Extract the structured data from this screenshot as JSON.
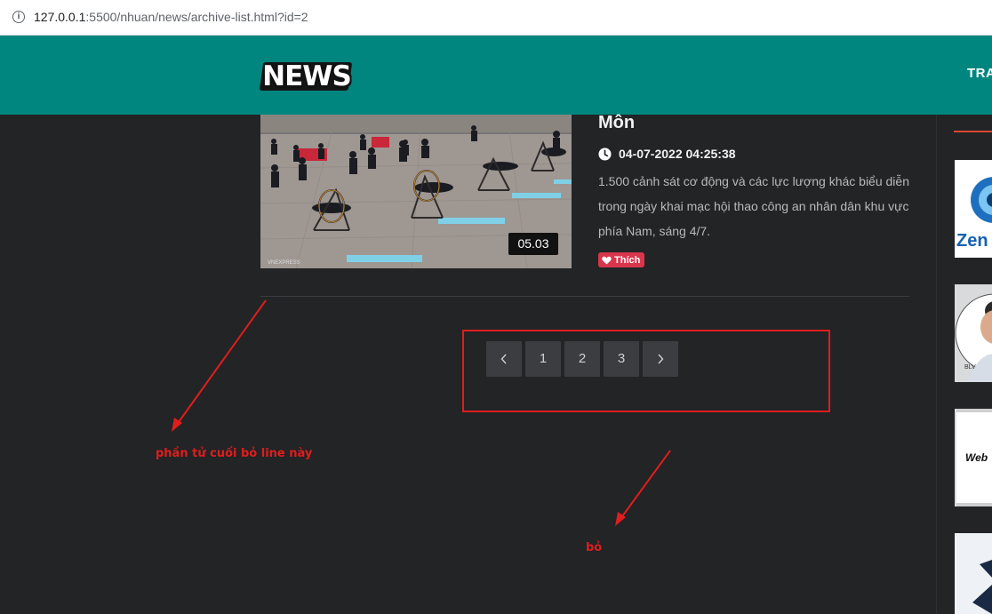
{
  "browser": {
    "url_host": "127.0.0.1",
    "url_rest": ":5500/nhuan/news/archive-list.html?id=2"
  },
  "header": {
    "logo_text": "NEWS",
    "nav_item": "TRA"
  },
  "article": {
    "title": "Môn",
    "date": "04-07-2022 04:25:38",
    "excerpt": "1.500 cảnh sát cơ động và các lực lượng khác biểu diễn trong ngày khai mạc hội thao công an nhân dân khu vực phía Nam, sáng 4/7.",
    "duration": "05.03",
    "like_label": "Thích"
  },
  "pagination": {
    "pages": [
      "1",
      "2",
      "3"
    ]
  },
  "annotations": {
    "left_note": "phần tử cuối bỏ line này",
    "bottom_note": "bỏ"
  },
  "sidebar": {
    "thumb_1_text": "Zen",
    "thumb_2_text": "BLV",
    "thumb_3_text": "Web"
  },
  "colors": {
    "header_bg": "#00867f",
    "page_bg": "#222426",
    "like_bg": "#d9354d",
    "annotation": "#e01d1d"
  }
}
